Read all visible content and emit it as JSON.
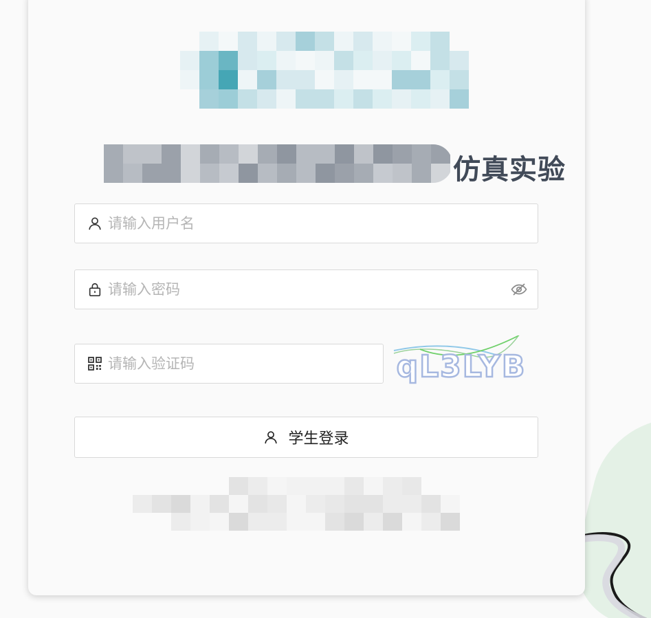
{
  "title": {
    "suffix_text": "仿真实验"
  },
  "login_form": {
    "username_placeholder": "请输入用户名",
    "password_placeholder": "请输入密码",
    "captcha_placeholder": "请输入验证码",
    "captcha_text": "qL3LYB",
    "submit_label": "学生登录"
  },
  "icons": {
    "username": "user-icon",
    "password": "lock-icon",
    "captcha": "qr-code-icon",
    "toggle_password": "eye-off-icon",
    "submit": "user-icon"
  },
  "colors": {
    "title": "#414a58",
    "placeholder": "#b5b5b5",
    "border": "#d9d9d9",
    "background": "#fafafa"
  }
}
